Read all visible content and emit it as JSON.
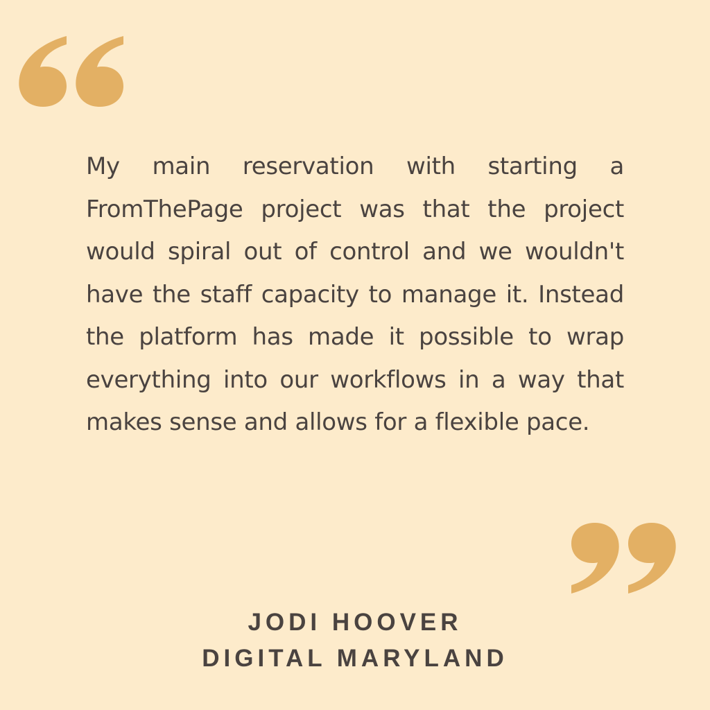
{
  "quote": {
    "text": "My main reservation with starting a FromThePage project was that the project would spiral out of control and we wouldn't have the staff capacity to manage it. Instead the platform has made it possible to wrap everything into our workflows in a way that makes sense and allows for a flexible pace.",
    "open_icon": "open-quote-icon",
    "close_icon": "close-quote-icon"
  },
  "attribution": {
    "name": "JODI HOOVER",
    "organization": "DIGITAL MARYLAND"
  },
  "colors": {
    "background": "#fdebcb",
    "accent": "#e3b064",
    "text": "#4a4340"
  }
}
